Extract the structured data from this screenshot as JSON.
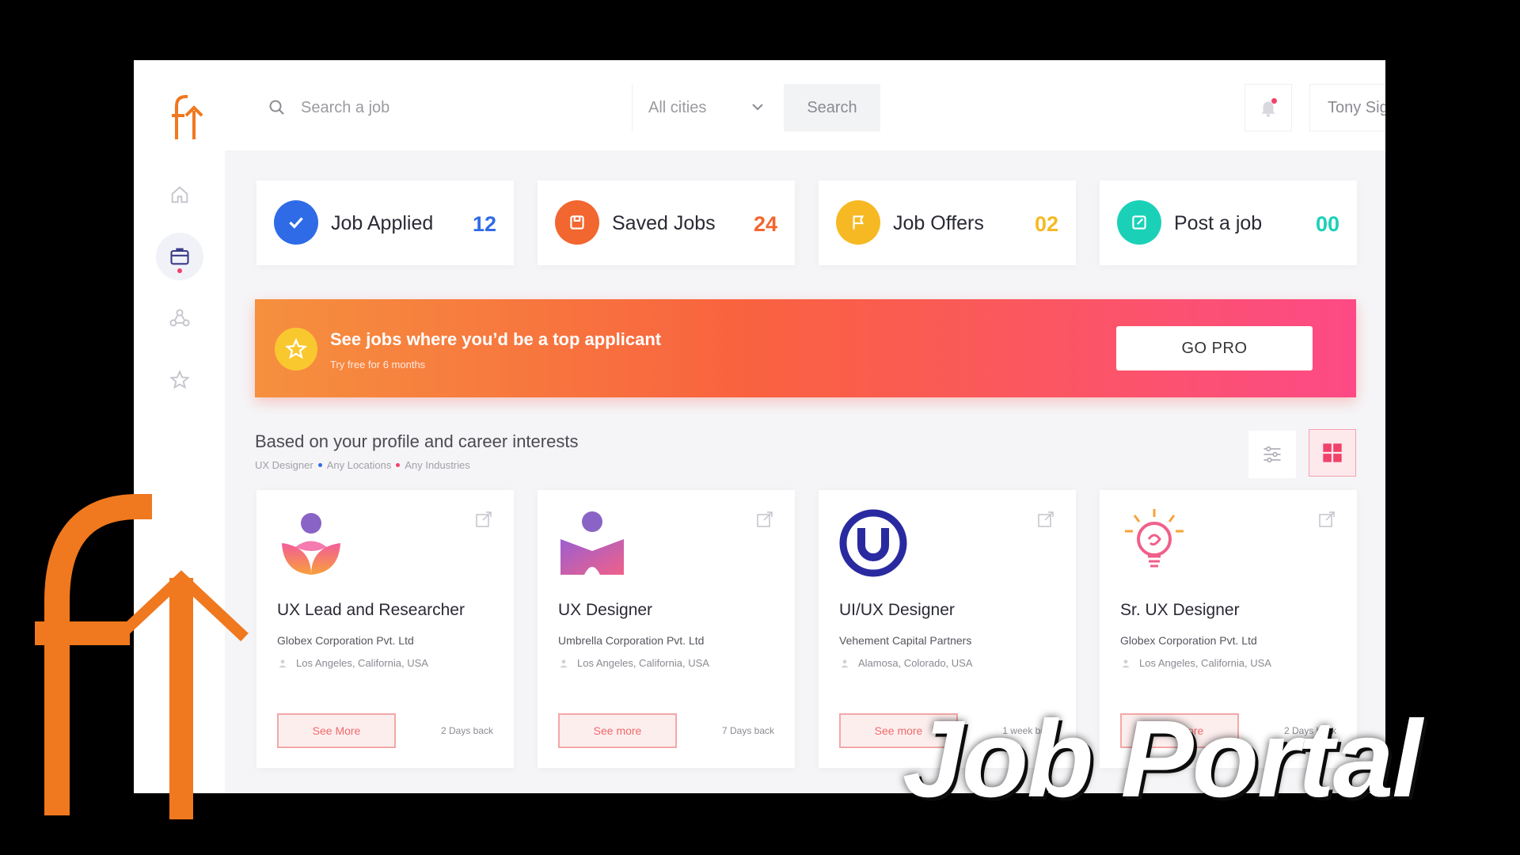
{
  "search": {
    "placeholder": "Search a job",
    "city": "All cities",
    "button": "Search"
  },
  "user": {
    "name": "Tony Signh"
  },
  "stats": [
    {
      "label": "Job Applied",
      "count": "12",
      "color": "#2f6be6"
    },
    {
      "label": "Saved Jobs",
      "count": "24",
      "color": "#f2662f"
    },
    {
      "label": "Job Offers",
      "count": "02",
      "color": "#f6b923"
    },
    {
      "label": "Post a job",
      "count": "00",
      "color": "#1ad1b8"
    }
  ],
  "banner": {
    "title": "See jobs where you’d be a top applicant",
    "subtitle": "Try free for 6 months",
    "button": "GO PRO"
  },
  "section": {
    "title": "Based on your profile and career interests",
    "tags": [
      "UX Designer",
      "Any Locations",
      "Any Industries"
    ]
  },
  "jobs": [
    {
      "title": "UX Lead and Researcher",
      "company": "Globex Corporation Pvt. Ltd",
      "location": "Los Angeles, California, USA",
      "button": "See More",
      "posted": "2 Days back"
    },
    {
      "title": "UX Designer",
      "company": "Umbrella Corporation Pvt. Ltd",
      "location": "Los Angeles, California, USA",
      "button": "See more",
      "posted": "7 Days back"
    },
    {
      "title": "UI/UX Designer",
      "company": "Vehement Capital Partners",
      "location": "Alamosa, Colorado, USA",
      "button": "See more",
      "posted": "1 week back"
    },
    {
      "title": "Sr. UX Designer",
      "company": "Globex Corporation Pvt. Ltd",
      "location": "Los Angeles, California, USA",
      "button": "See more",
      "posted": "2 Days back"
    }
  ],
  "watermark": {
    "text": "Job Portal"
  },
  "brand": {
    "orange": "#f0781e",
    "pink": "#f0426a"
  }
}
